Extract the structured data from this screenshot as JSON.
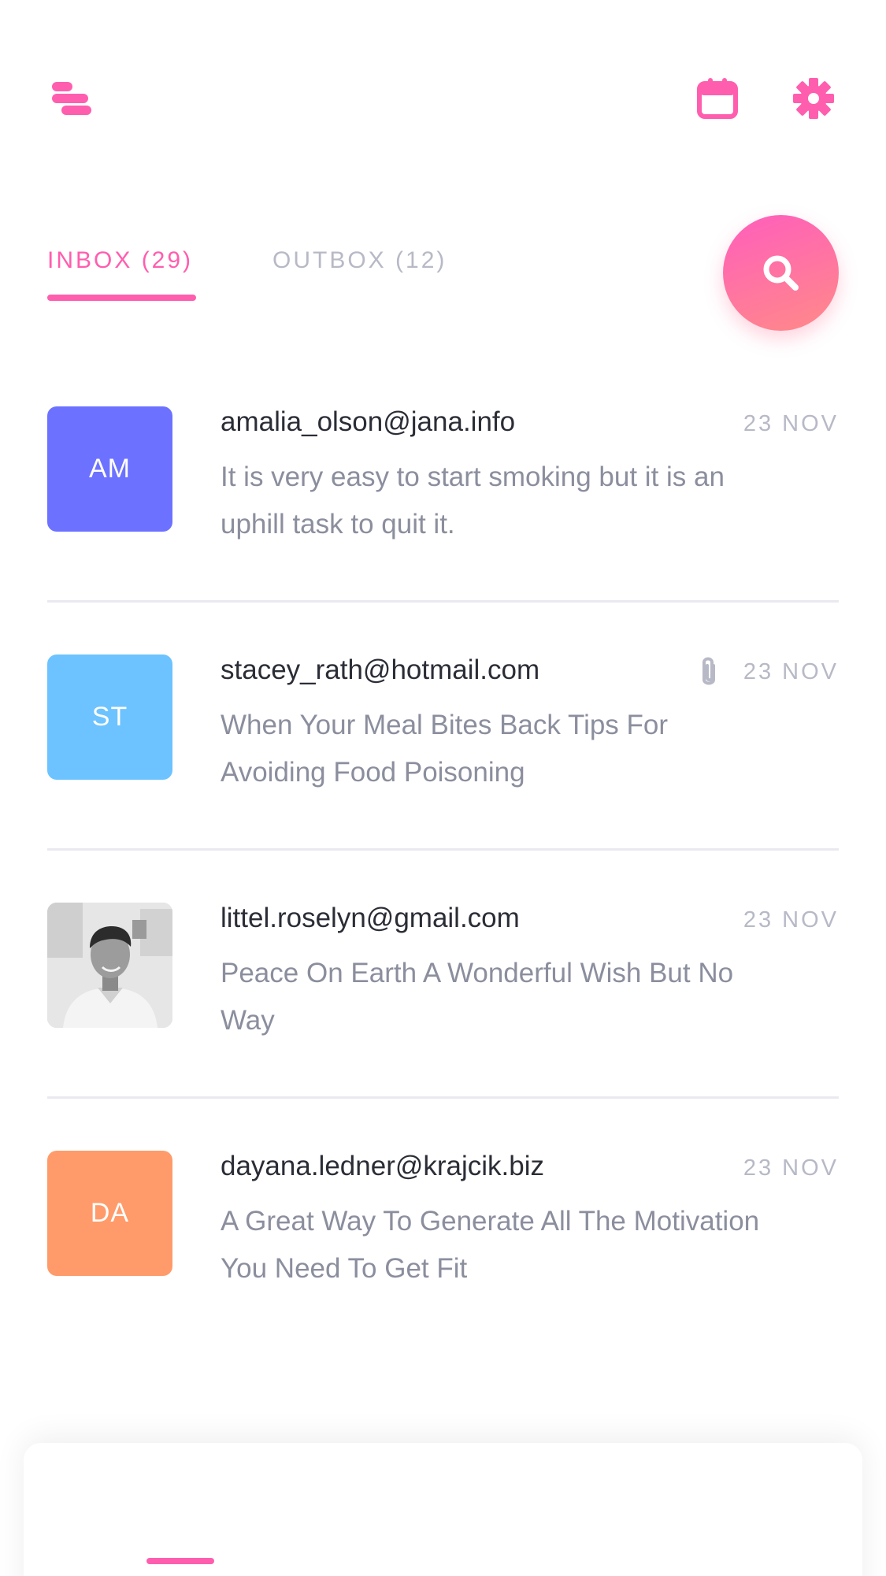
{
  "header": {
    "menu_icon": "menu-icon",
    "calendar_icon": "calendar-icon",
    "settings_icon": "gear-icon"
  },
  "tabs": [
    {
      "label": "INBOX (29)",
      "active": true
    },
    {
      "label": "OUTBOX (12)",
      "active": false
    }
  ],
  "search_icon": "search-icon",
  "colors": {
    "accent": "#ff5eae",
    "divider": "#e9e9f0"
  },
  "emails": [
    {
      "avatar_text": "AM",
      "avatar_color": "#6c72ff",
      "sender": "amalia_olson@jana.info",
      "preview": "It is very easy to start smoking but it is an uphill task to quit it.",
      "date": "23 NOV",
      "attachment": false
    },
    {
      "avatar_text": "ST",
      "avatar_color": "#6cc3ff",
      "sender": "stacey_rath@hotmail.com",
      "preview": "When Your Meal Bites Back Tips For Avoiding Food Poisoning",
      "date": "23 NOV",
      "attachment": true
    },
    {
      "avatar_text": "",
      "avatar_color": "#d8d8d8",
      "sender": "littel.roselyn@gmail.com",
      "preview": "Peace On Earth A Wonderful Wish But No Way",
      "date": "23 NOV",
      "attachment": false
    },
    {
      "avatar_text": "DA",
      "avatar_color": "#ff9b6a",
      "sender": "dayana.ledner@krajcik.biz",
      "preview": "A Great Way To Generate All The Motivation You Need To Get Fit",
      "date": "23 NOV",
      "attachment": false
    }
  ]
}
